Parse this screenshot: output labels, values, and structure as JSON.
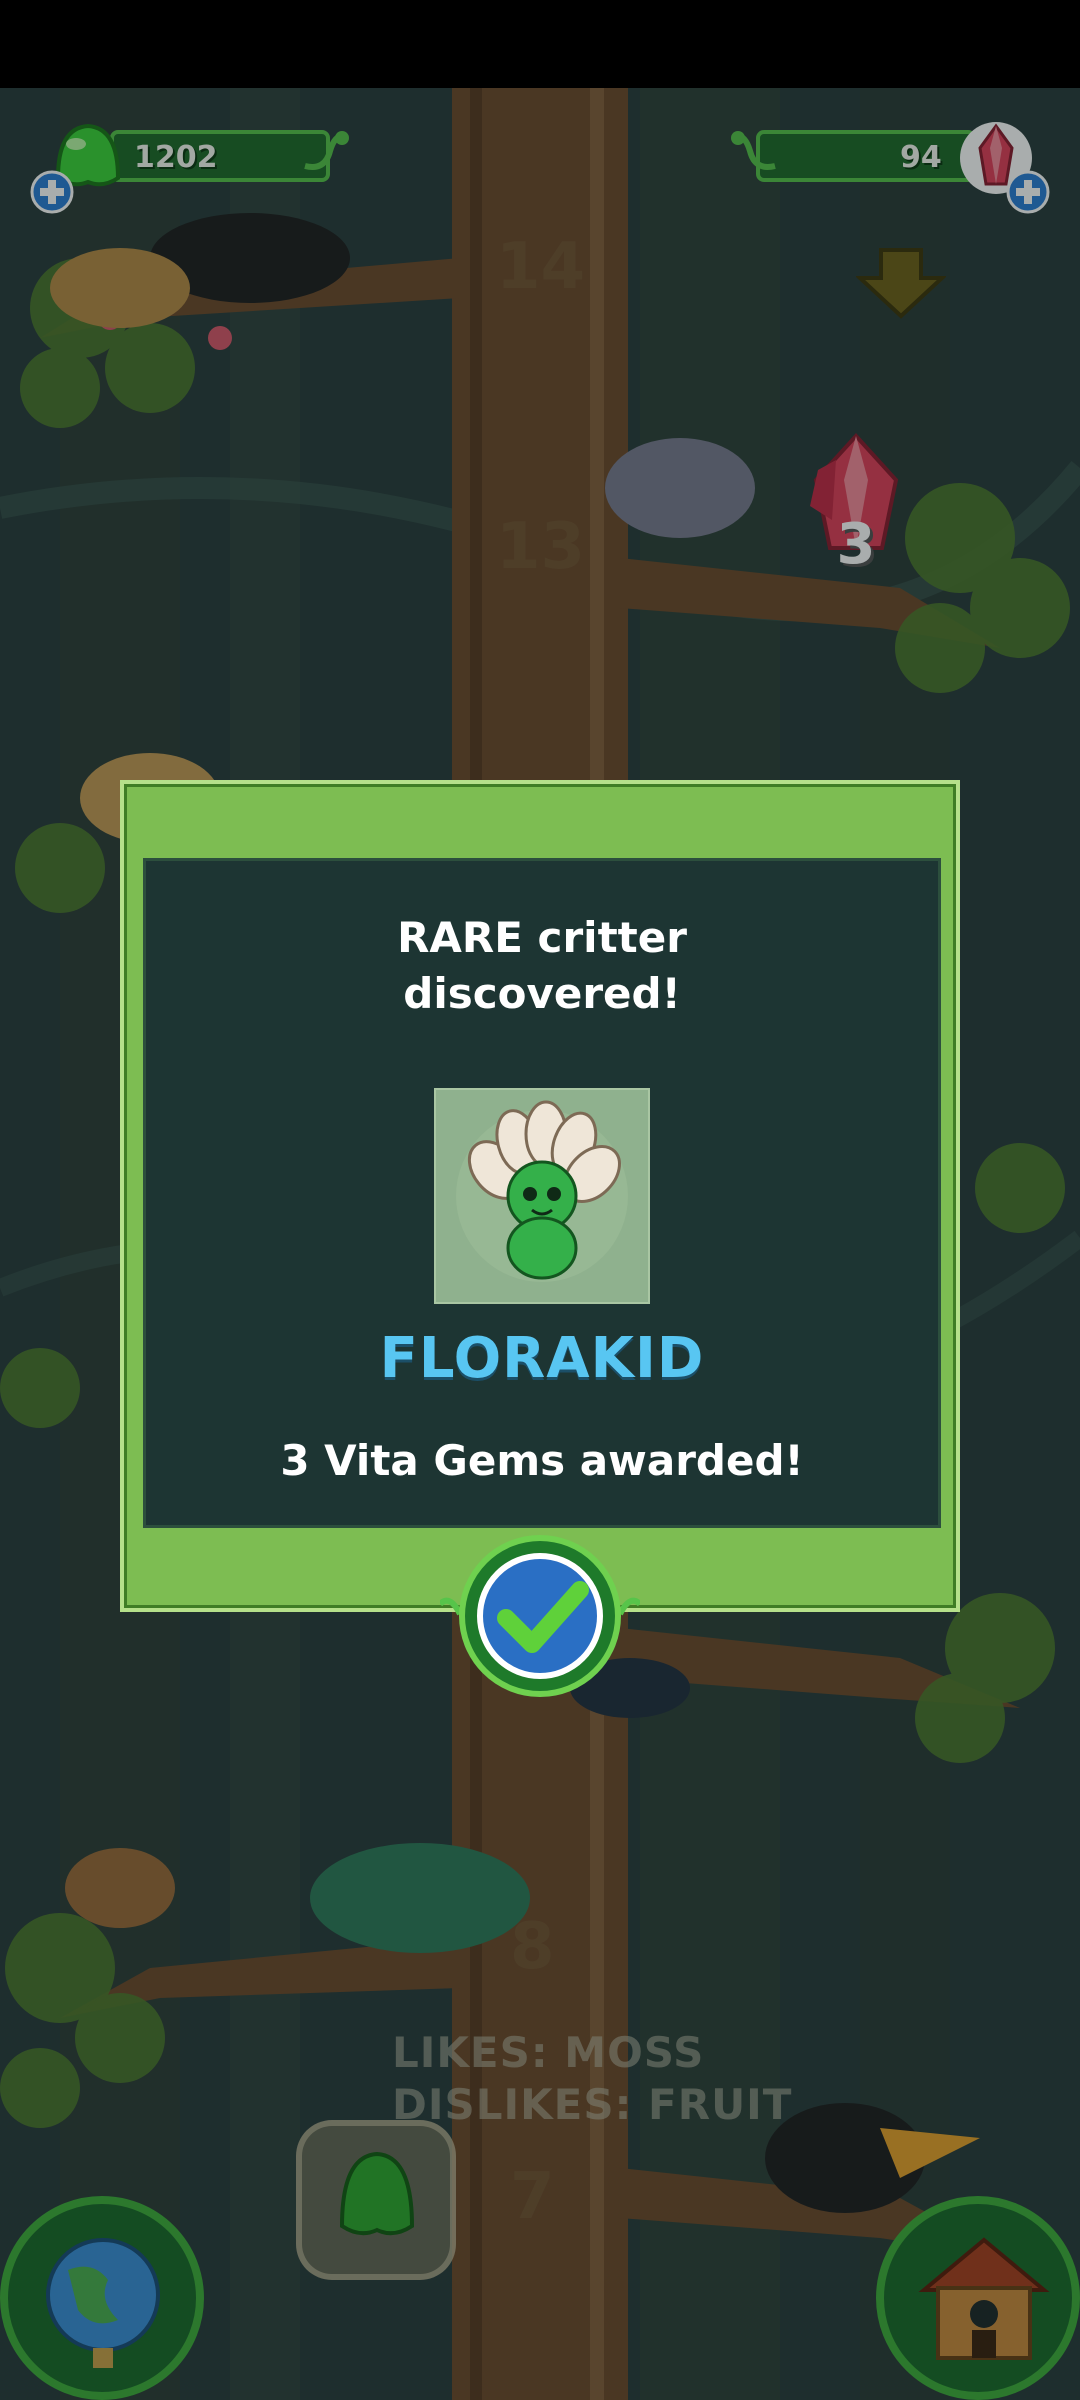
{
  "hud": {
    "jelly_count": "1202",
    "gem_count": "94"
  },
  "tree_levels": {
    "level_14": "14",
    "level_13": "13",
    "level_8": "8",
    "level_7": "7"
  },
  "gem_pickup": {
    "count": "3"
  },
  "modal": {
    "title_line1": "RARE critter",
    "title_line2": "discovered!",
    "critter_name": "FLORAKID",
    "reward": "3 Vita Gems awarded!"
  },
  "critter_info": {
    "likes": "LIKES: MOSS",
    "dislikes": "DISLIKES: FRUIT"
  },
  "colors": {
    "frame_green": "#7dbd52",
    "panel_dark": "#1d3533",
    "name_blue": "#58c6f2",
    "gem_red": "#e0405a"
  },
  "icons": [
    "jelly-icon",
    "gem-icon",
    "add-icon",
    "down-arrow-icon",
    "checkmark-icon",
    "globe-icon",
    "house-icon",
    "jelly-feed-icon"
  ]
}
